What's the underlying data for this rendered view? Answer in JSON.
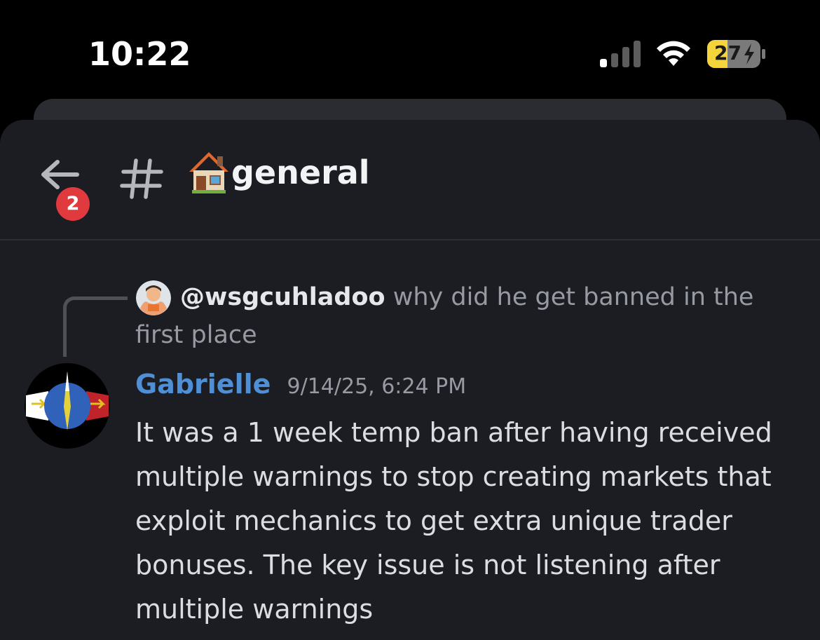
{
  "status_bar": {
    "time": "10:22",
    "battery_level": "27",
    "battery_fraction": 0.27,
    "battery_state": "charging",
    "battery_color": "#f5d33b",
    "signal_bars_active": 1,
    "signal_bars_total": 4,
    "icons": [
      "cellular-signal-icon",
      "wifi-icon",
      "battery-charging-icon"
    ]
  },
  "header": {
    "back_icon": "arrow-left-icon",
    "unread_badge": "2",
    "channel_icon": "hash-icon",
    "channel_emoji": "house-icon",
    "channel_name": "general"
  },
  "reply": {
    "author": "@wsgcuhladoo",
    "text": "why did he get banned in the first place"
  },
  "message": {
    "author": "Gabrielle",
    "author_color": "#4e8fd6",
    "timestamp": "9/14/25, 6:24 PM",
    "body": "It was a 1 week temp ban after having received multiple warnings to stop creating markets that exploit mechanics to get extra unique trader bonuses. The key issue is not listening after multiple warnings"
  },
  "colors": {
    "background": "#1c1d22",
    "badge": "#e0393e",
    "text": "#dbdee1",
    "muted": "#979aa3"
  }
}
